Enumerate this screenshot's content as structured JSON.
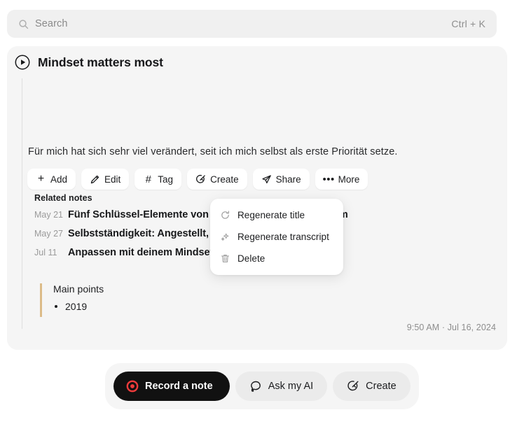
{
  "search": {
    "placeholder": "Search",
    "shortcut": "Ctrl + K",
    "icon": "search-icon"
  },
  "note": {
    "title": "Mindset matters most",
    "play_icon": "play-circle-icon",
    "transcript": "Für mich hat sich sehr viel verändert, seit ich mich selbst als erste Priorität setze.",
    "timestamp": "9:50 AM  ·  Jul 16, 2024",
    "accent_color": "#dcbb88"
  },
  "actions": [
    {
      "label": "Add",
      "icon": "plus-icon",
      "glyph": "+"
    },
    {
      "label": "Edit",
      "icon": "pencil-icon"
    },
    {
      "label": "Tag",
      "icon": "hash-icon",
      "glyph": "#"
    },
    {
      "label": "Create",
      "icon": "magic-wand-icon"
    },
    {
      "label": "Share",
      "icon": "paper-plane-icon"
    },
    {
      "label": "More",
      "icon": "ellipsis-icon",
      "glyph": "•••"
    }
  ],
  "related": {
    "heading": "Related notes",
    "items": [
      {
        "date": "May 21",
        "name": "Fünf Schlüssel-Elemente von Veränderung und Wachstum"
      },
      {
        "date": "May 27",
        "name": "Selbstständigkeit: Angestellt, Beides oder nichts"
      },
      {
        "date": "Jul 11",
        "name": "Anpassen mit deinem Mindset für Selbstständigkeit"
      }
    ]
  },
  "dropdown": {
    "items": [
      {
        "label": "Regenerate title",
        "icon": "refresh-icon"
      },
      {
        "label": "Regenerate transcript",
        "icon": "sparkles-icon"
      },
      {
        "label": "Delete",
        "icon": "trash-icon"
      }
    ]
  },
  "main_points": {
    "heading": "Main points",
    "items": [
      "2019"
    ]
  },
  "toolbar": {
    "record_label": "Record a note",
    "record_icon": "record-dot-icon",
    "record_icon_color": "#ef3b3b",
    "ask_label": "Ask my AI",
    "ask_icon": "chat-bubble-icon",
    "create_label": "Create",
    "create_icon": "magic-wand-icon"
  }
}
